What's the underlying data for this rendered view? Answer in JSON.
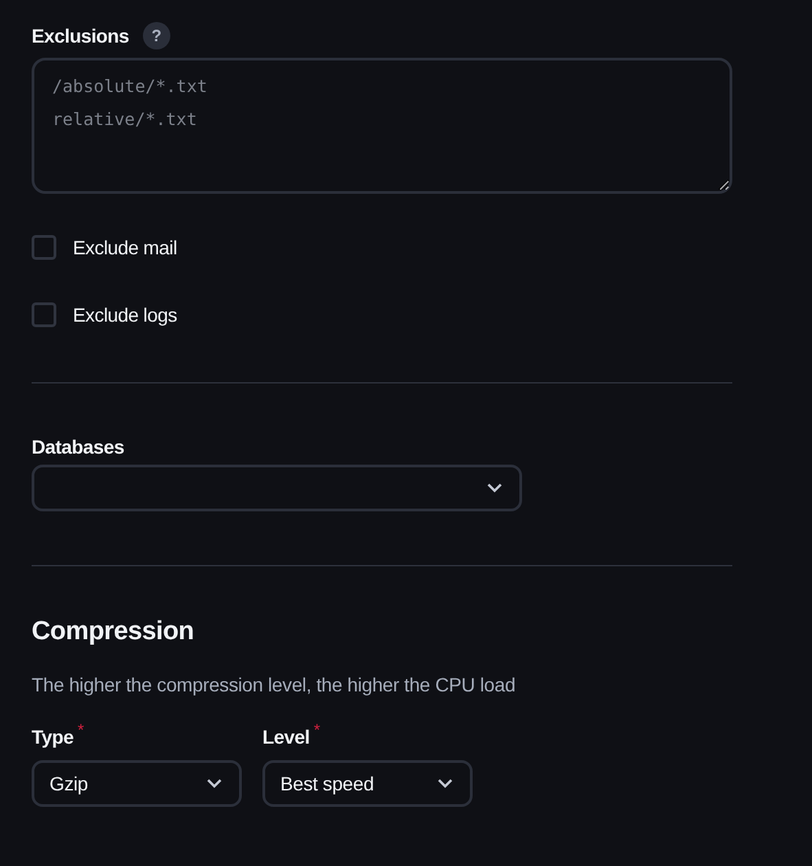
{
  "exclusions": {
    "label": "Exclusions",
    "help": "?",
    "placeholder": "/absolute/*.txt\nrelative/*.txt"
  },
  "checkboxes": [
    {
      "label": "Exclude mail",
      "checked": false
    },
    {
      "label": "Exclude logs",
      "checked": false
    }
  ],
  "databases": {
    "label": "Databases"
  },
  "compression": {
    "title": "Compression",
    "description": "The higher the compression level, the higher the CPU load",
    "fields": [
      {
        "label": "Type",
        "required_mark": "*",
        "value": "Gzip"
      },
      {
        "label": "Level",
        "required_mark": "*",
        "value": "Best speed"
      }
    ]
  }
}
